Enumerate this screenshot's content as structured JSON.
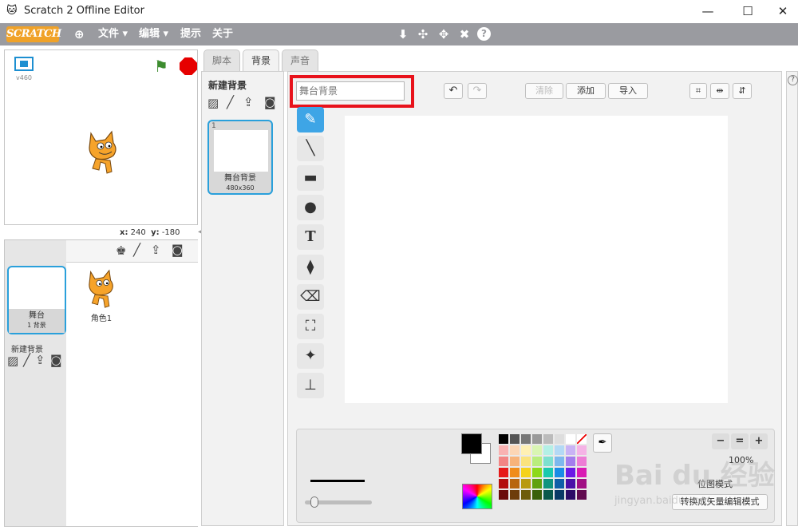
{
  "window": {
    "title": "Scratch 2 Offline Editor",
    "minimize": "—",
    "maximize": "☐",
    "close": "✕"
  },
  "menubar": {
    "logo": "SCRATCH",
    "items": [
      "文件 ▾",
      "编辑 ▾",
      "提示",
      "关于"
    ],
    "tools": [
      "⬇",
      "✣",
      "✥",
      "✖",
      "?"
    ]
  },
  "stage": {
    "version": "v460",
    "coord_x_label": "x:",
    "coord_x": "240",
    "coord_y_label": "y:",
    "coord_y": "-180"
  },
  "sprites": {
    "stage_label": "舞台",
    "stage_sub": "1 背景",
    "sprite1_label": "角色1",
    "new_backdrop_label": "新建背景"
  },
  "tabs": [
    "脚本",
    "背景",
    "声音"
  ],
  "costumes": {
    "new_title": "新建背景",
    "item_number": "1",
    "item_name": "舞台背景",
    "item_size": "480x360"
  },
  "editor": {
    "name_placeholder": "舞台背景",
    "buttons": {
      "clear": "清除",
      "add": "添加",
      "import": "导入"
    },
    "zoom": "100%",
    "mode": "位图模式",
    "convert": "转换成矢量编辑模式"
  },
  "watermark": {
    "main": "Bai du 经验",
    "sub": "jingyan.baidu.com"
  },
  "colors": {
    "accent": "#2aa0db",
    "menubar": "#9a9ba0",
    "highlight": "#e8121b"
  }
}
